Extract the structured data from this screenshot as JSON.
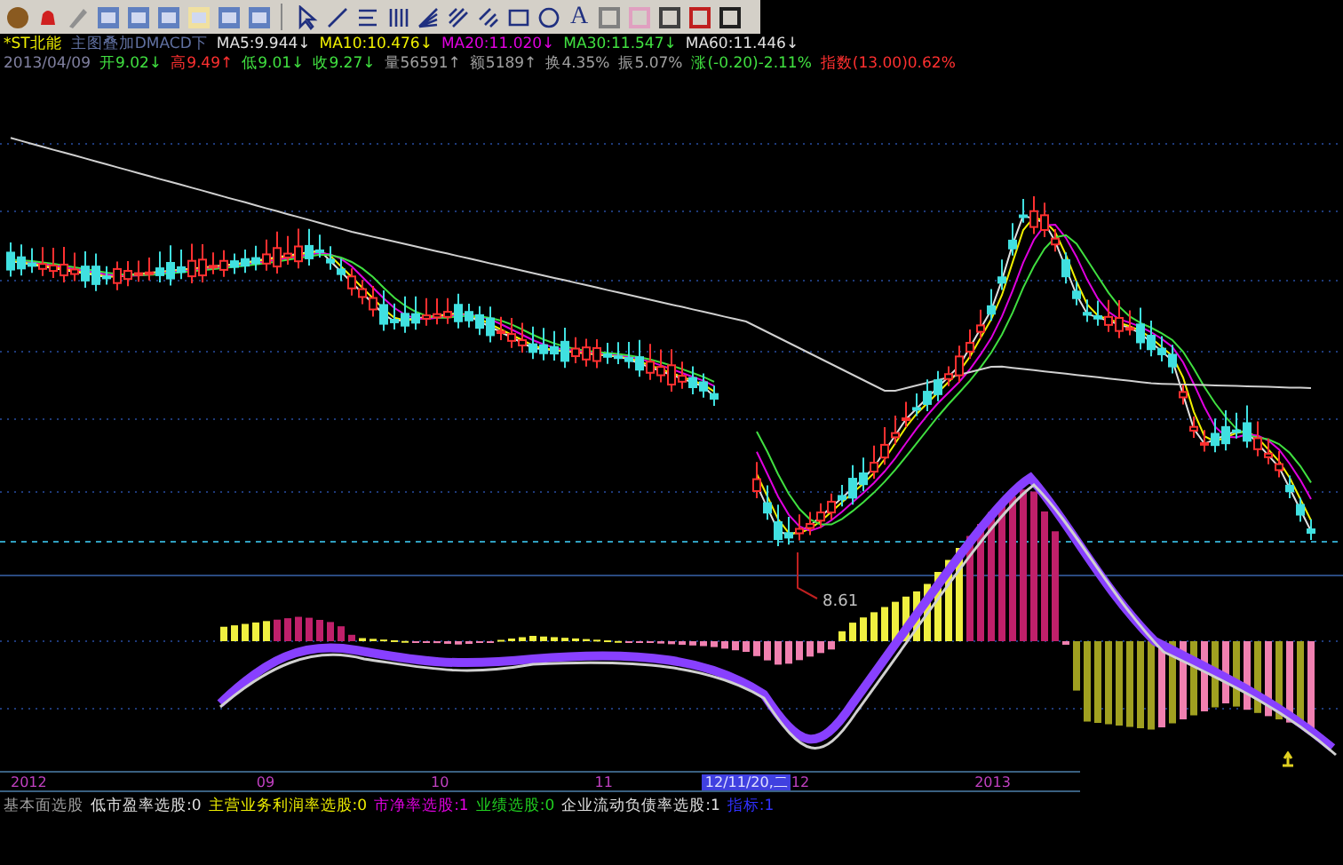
{
  "toolbar": {
    "text_tool": "A"
  },
  "quote_header": {
    "stock_name": "*ST北能",
    "overlay": "主图叠加DMACD下",
    "moving_averages": [
      {
        "label": "MA5:9.944↓",
        "color": "#e0e0e0"
      },
      {
        "label": "MA10:10.476↓",
        "color": "#f0f000"
      },
      {
        "label": "MA20:11.020↓",
        "color": "#e000e0"
      },
      {
        "label": "MA30:11.547↓",
        "color": "#40e040"
      },
      {
        "label": "MA60:11.446↓",
        "color": "#e0e0e0"
      }
    ],
    "date": "2013/04/09",
    "fields": [
      {
        "label": "开9.02↓",
        "color": "#40e040"
      },
      {
        "label": "高9.49↑",
        "color": "#ff3030"
      },
      {
        "label": "低9.01↓",
        "color": "#40e040"
      },
      {
        "label": "收9.27↓",
        "color": "#40e040"
      },
      {
        "label": "量56591↑",
        "color": "#a0a0a0"
      },
      {
        "label": "额5189↑",
        "color": "#a0a0a0"
      },
      {
        "label": "换4.35%",
        "color": "#a0a0a0"
      },
      {
        "label": "振5.07%",
        "color": "#a0a0a0"
      },
      {
        "label": "涨(-0.20)-2.11%",
        "color": "#40e040"
      },
      {
        "label": "指数(13.00)0.62%",
        "color": "#ff3030"
      }
    ]
  },
  "chart": {
    "low_label": "8.61"
  },
  "date_axis": [
    {
      "label": "2012",
      "selected": false
    },
    {
      "label": "09",
      "selected": false
    },
    {
      "label": "10",
      "selected": false
    },
    {
      "label": "11",
      "selected": false
    },
    {
      "label": "12/11/20,二",
      "selected": true
    },
    {
      "label": "12",
      "selected": false
    },
    {
      "label": "2013",
      "selected": false
    }
  ],
  "screen_bar": [
    {
      "label": "基本面选股",
      "color": "#a0a0a0"
    },
    {
      "label": "低市盈率选股:0",
      "color": "#e0e0e0"
    },
    {
      "label": "主营业务利润率选股:0",
      "color": "#f0f000"
    },
    {
      "label": "市净率选股:1",
      "color": "#e000e0"
    },
    {
      "label": "业绩选股:0",
      "color": "#20d020"
    },
    {
      "label": "企业流动负债率选股:1",
      "color": "#e0e0e0"
    },
    {
      "label": "指标:1",
      "color": "#3030ff"
    }
  ]
}
